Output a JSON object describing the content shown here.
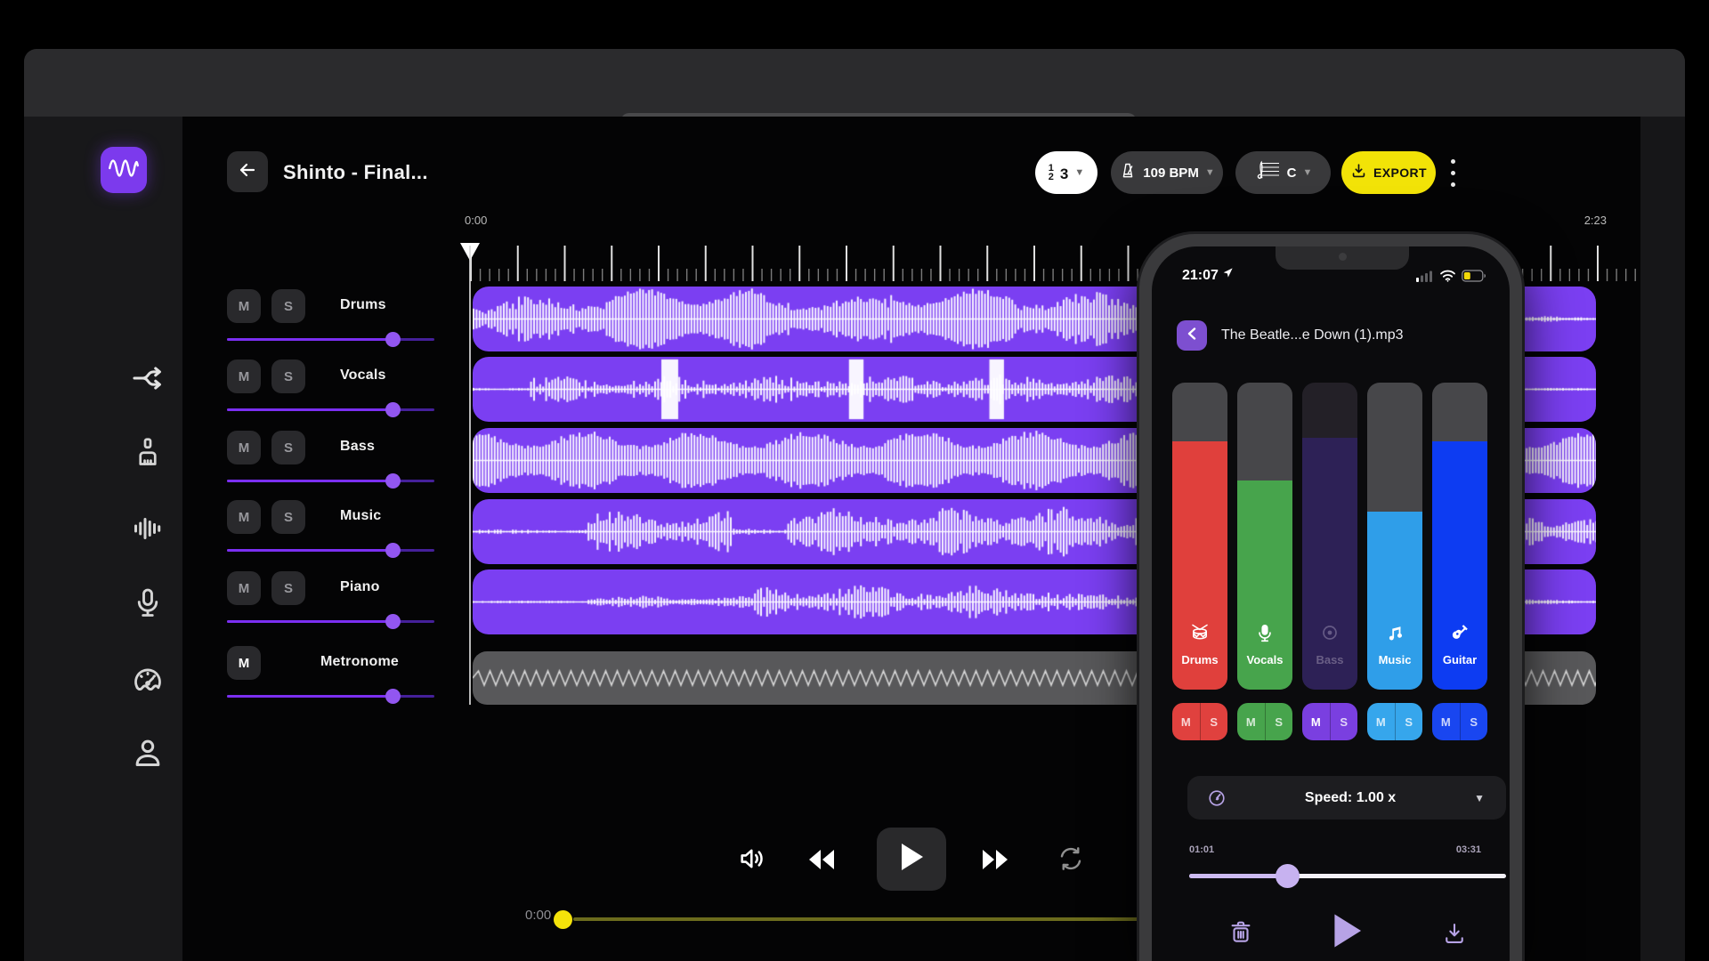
{
  "browser": {
    "traffic_lights": [
      "#ff5f57",
      "#febc2e",
      "#28c840"
    ],
    "address_bar_text": ""
  },
  "sidebar": {
    "items": [
      {
        "id": "app-logo",
        "icon": "waveform-logo-icon"
      },
      {
        "id": "split-stems",
        "icon": "split-icon"
      },
      {
        "id": "cleanup",
        "icon": "broom-icon"
      },
      {
        "id": "audio-levels",
        "icon": "equalizer-icon"
      },
      {
        "id": "record",
        "icon": "microphone-icon"
      },
      {
        "id": "tempo",
        "icon": "gauge-icon"
      },
      {
        "id": "account",
        "icon": "person-icon"
      }
    ]
  },
  "header": {
    "title": "Shinto - Final...",
    "time_signature": {
      "top": "1",
      "bottom": "2",
      "main": "3"
    },
    "bpm_label": "109 BPM",
    "key_label": "C",
    "export_label": "EXPORT"
  },
  "timeline": {
    "start_time": "0:00",
    "end_time": "2:23"
  },
  "tracks": [
    {
      "name": "Drums",
      "buttons": [
        "M",
        "S"
      ],
      "volume": 0.8,
      "wave": {
        "style": "bars",
        "seed": 11,
        "segments": [
          [
            0,
            0.04,
            0.3,
            0.7
          ],
          [
            0.04,
            0.12,
            0.45,
            0.85
          ],
          [
            0.12,
            0.26,
            0.8,
            1.0
          ],
          [
            0.26,
            0.37,
            0.45,
            0.8
          ],
          [
            0.37,
            0.48,
            0.75,
            1.0
          ],
          [
            0.48,
            0.93,
            0.5,
            0.9
          ],
          [
            0.93,
            1,
            0.04,
            0.1
          ]
        ],
        "blocks": []
      }
    },
    {
      "name": "Vocals",
      "buttons": [
        "M",
        "S"
      ],
      "volume": 0.8,
      "wave": {
        "style": "bars",
        "seed": 22,
        "segments": [
          [
            0,
            0.05,
            0.02,
            0.06
          ],
          [
            0.05,
            0.3,
            0.08,
            0.45
          ],
          [
            0.3,
            0.62,
            0.12,
            0.5
          ],
          [
            0.62,
            0.9,
            0.08,
            0.45
          ],
          [
            0.9,
            1,
            0.02,
            0.05
          ]
        ],
        "blocks": [
          [
            0.168,
            0.183
          ],
          [
            0.335,
            0.348
          ],
          [
            0.46,
            0.473
          ]
        ]
      }
    },
    {
      "name": "Bass",
      "buttons": [
        "M",
        "S"
      ],
      "volume": 0.8,
      "wave": {
        "style": "bars",
        "seed": 33,
        "segments": [
          [
            0,
            1,
            0.72,
            0.97
          ]
        ],
        "blocks": []
      }
    },
    {
      "name": "Music",
      "buttons": [
        "M",
        "S"
      ],
      "volume": 0.8,
      "wave": {
        "style": "bars",
        "seed": 44,
        "segments": [
          [
            0,
            0.1,
            0.02,
            0.08
          ],
          [
            0.1,
            0.23,
            0.25,
            0.7
          ],
          [
            0.23,
            0.28,
            0.04,
            0.12
          ],
          [
            0.28,
            0.56,
            0.3,
            0.8
          ],
          [
            0.56,
            0.9,
            0.25,
            0.7
          ],
          [
            0.9,
            1,
            0.25,
            0.6
          ]
        ],
        "blocks": []
      }
    },
    {
      "name": "Piano",
      "buttons": [
        "M",
        "S"
      ],
      "volume": 0.8,
      "wave": {
        "style": "bars",
        "seed": 55,
        "segments": [
          [
            0,
            0.1,
            0.02,
            0.05
          ],
          [
            0.1,
            0.25,
            0.06,
            0.2
          ],
          [
            0.25,
            0.52,
            0.15,
            0.55
          ],
          [
            0.52,
            0.9,
            0.08,
            0.3
          ],
          [
            0.9,
            1,
            0.03,
            0.08
          ]
        ],
        "blocks": []
      }
    },
    {
      "name": "Metronome",
      "buttons": [
        "M"
      ],
      "volume": 0.8,
      "wave": {
        "style": "zigzag"
      }
    }
  ],
  "transport": {
    "controls": [
      "volume",
      "rewind",
      "play",
      "fast-forward",
      "loop"
    ]
  },
  "bottom_bar": {
    "current_time": "0:00",
    "progress": 0
  },
  "phone": {
    "status_bar": {
      "time": "21:07"
    },
    "header": {
      "title": "The Beatle...e Down (1).mp3"
    },
    "mute_label": "M",
    "solo_label": "S",
    "stems": [
      {
        "label": "Drums",
        "icon": "drum-icon",
        "fill": 0.81,
        "color": "#e0403c",
        "ms_color": "#e0413e",
        "muted": false
      },
      {
        "label": "Vocals",
        "icon": "microphone-icon",
        "fill": 0.68,
        "color": "#47a44c",
        "ms_color": "#47a44c",
        "muted": false
      },
      {
        "label": "Bass",
        "icon": "record-icon",
        "fill": 0.82,
        "color": "#2d2156",
        "ms_color": "#7a3fe0",
        "muted": true
      },
      {
        "label": "Music",
        "icon": "music-note-icon",
        "fill": 0.58,
        "color": "#2f9ee9",
        "ms_color": "#36a6ec",
        "muted": false
      },
      {
        "label": "Guitar",
        "icon": "guitar-icon",
        "fill": 0.81,
        "color": "#0d3cf2",
        "ms_color": "#1946f0",
        "muted": false
      }
    ],
    "speed": {
      "label": "Speed: 1.00 x"
    },
    "progress": {
      "elapsed": "01:01",
      "total": "03:31",
      "fraction": 0.31
    }
  },
  "colors": {
    "accent_purple": "#7b3ff2",
    "logo_purple": "#7c3aed",
    "export_yellow": "#f2e307",
    "progress_yellow": "#f4e20a",
    "metronome_gray": "#58585a",
    "phone_slider_lavender": "#c7b2f0"
  }
}
